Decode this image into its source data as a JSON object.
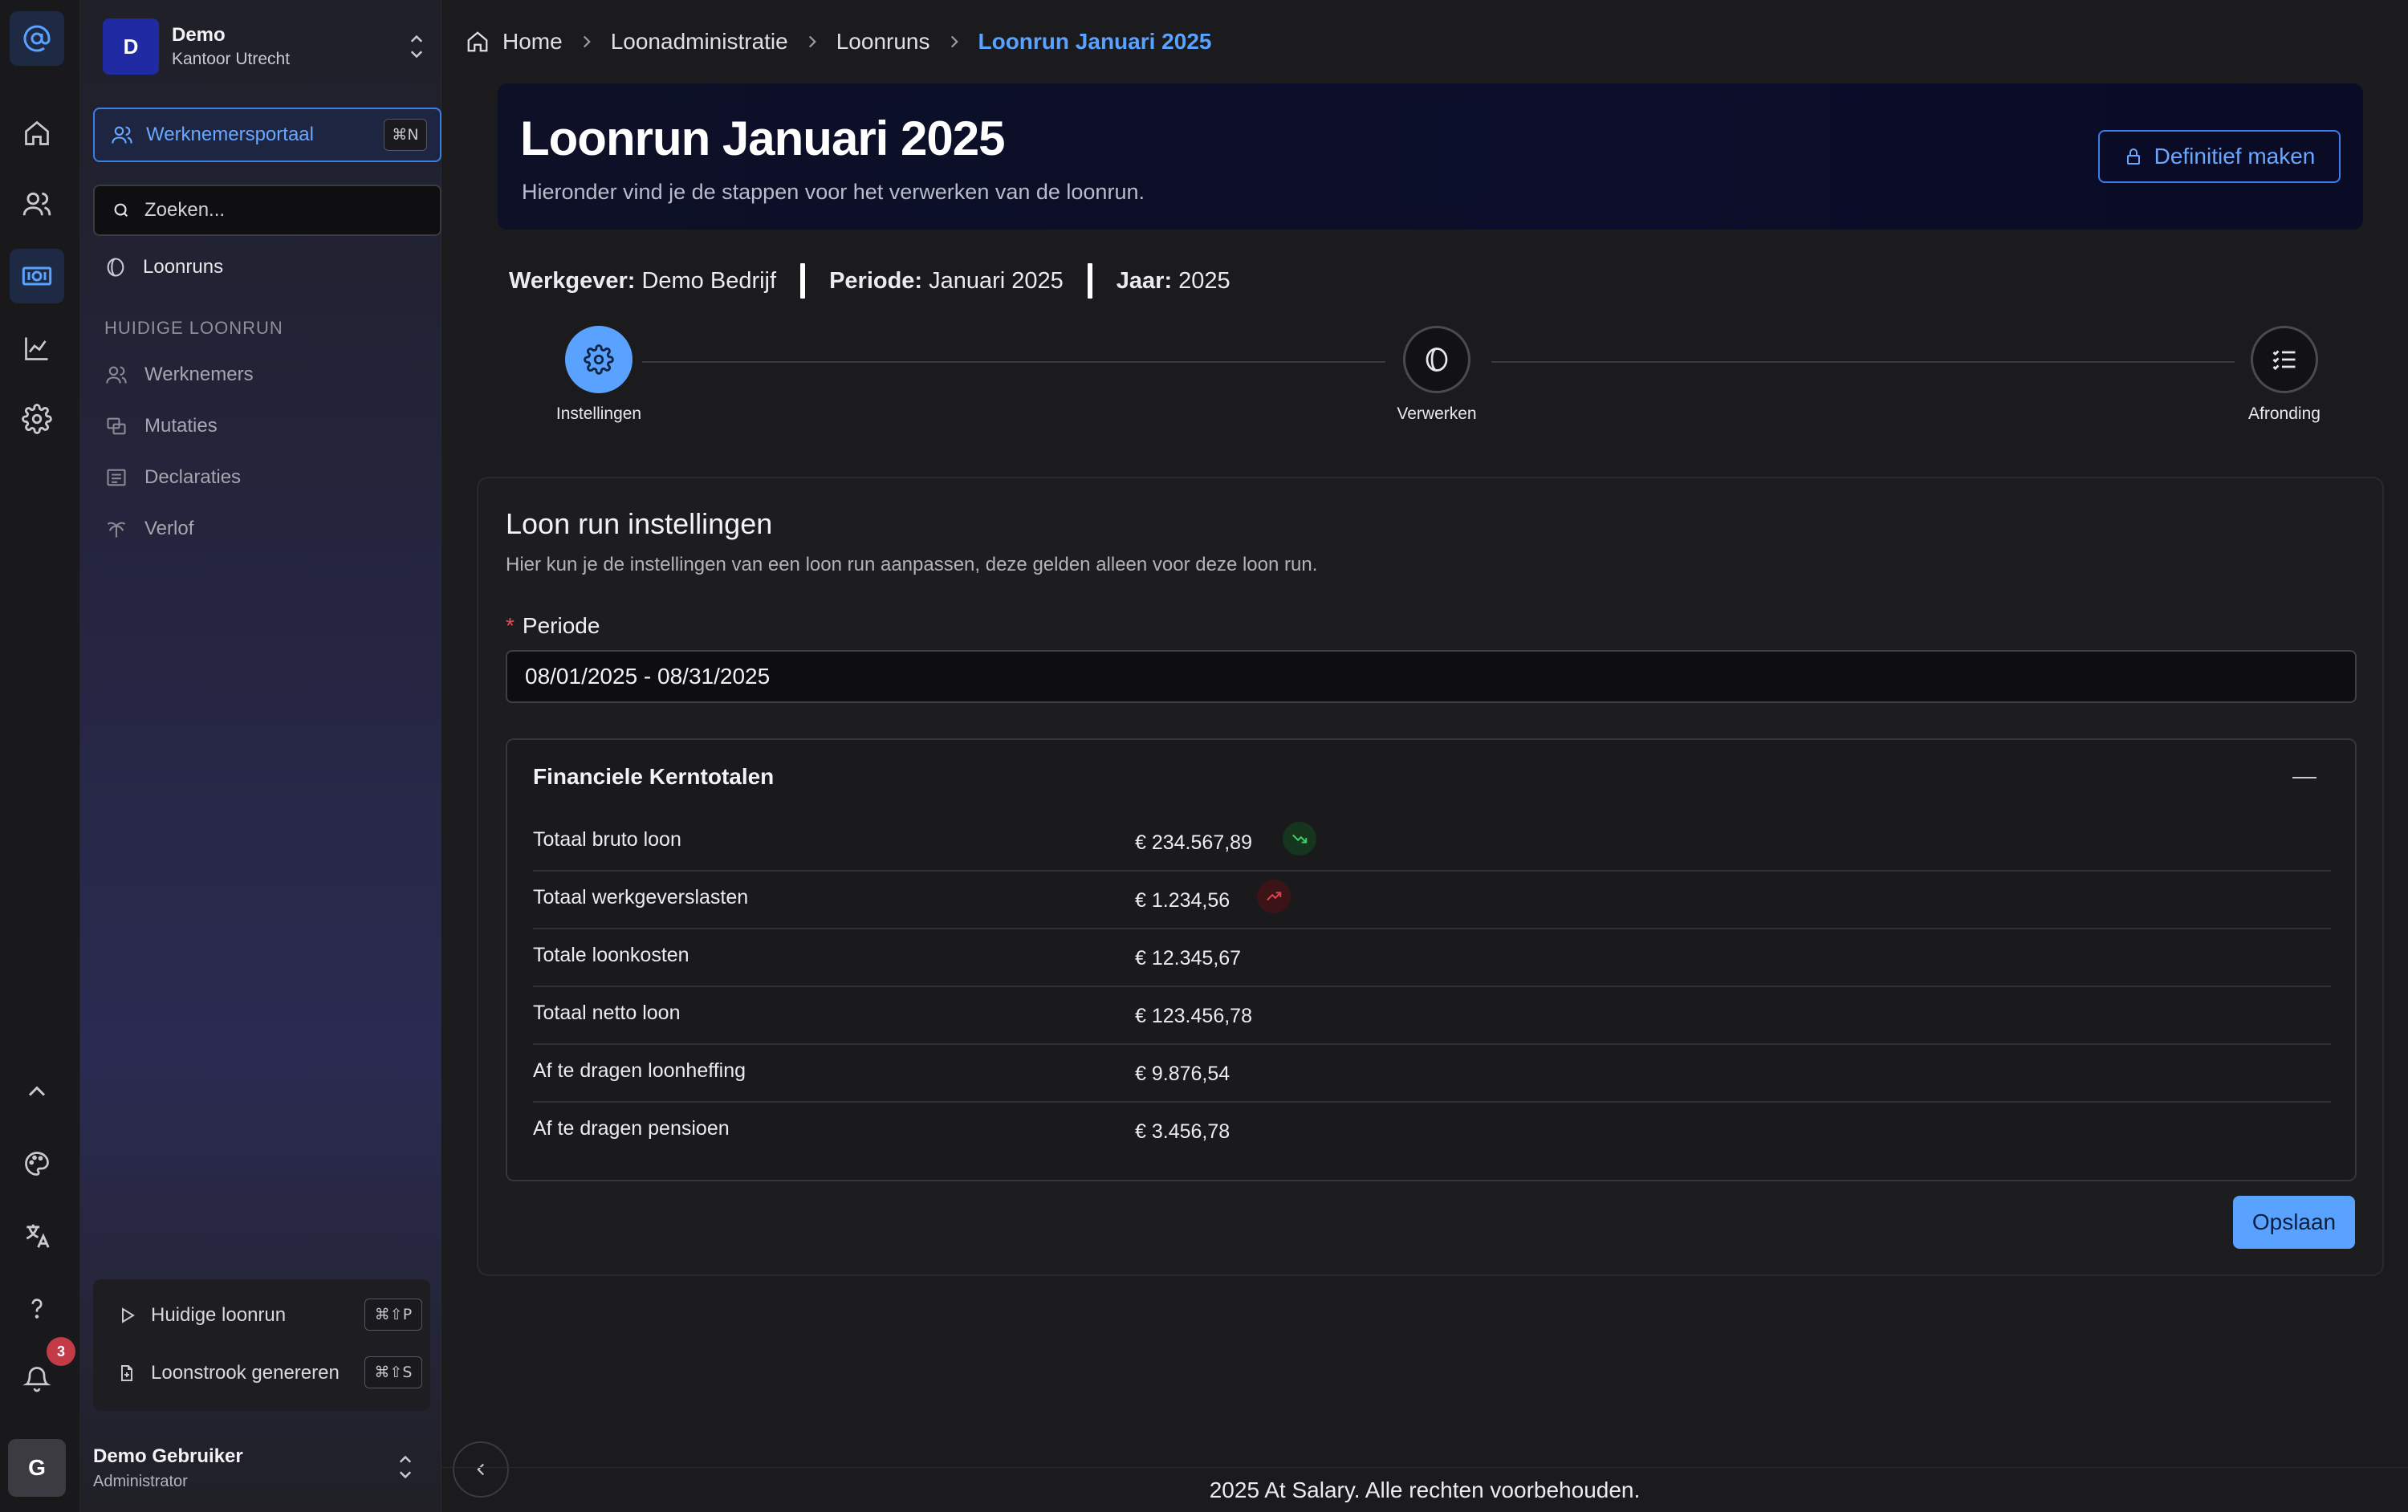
{
  "org": {
    "initial": "D",
    "name": "Demo",
    "office": "Kantoor Utrecht"
  },
  "sidebar": {
    "portal_label": "Werknemersportaal",
    "portal_shortcut": "⌘N",
    "search_placeholder": "Zoeken...",
    "top_items": [
      {
        "label": "Loonruns",
        "icon": "coin-icon"
      }
    ],
    "section_label": "HUIDIGE LOONRUN",
    "section_items": [
      {
        "label": "Werknemers",
        "icon": "users-icon"
      },
      {
        "label": "Mutaties",
        "icon": "swap-icon"
      },
      {
        "label": "Declaraties",
        "icon": "receipt-icon"
      },
      {
        "label": "Verlof",
        "icon": "palm-tree-icon"
      }
    ],
    "quick_actions": [
      {
        "label": "Huidige loonrun",
        "shortcut": "⌘⇧P",
        "icon": "play-icon"
      },
      {
        "label": "Loonstrook genereren",
        "shortcut": "⌘⇧S",
        "icon": "file-plus-icon"
      }
    ]
  },
  "rail": {
    "notification_count": "3"
  },
  "user": {
    "initial": "G",
    "name": "Demo Gebruiker",
    "role": "Administrator"
  },
  "breadcrumb": [
    "Home",
    "Loonadministratie",
    "Loonruns",
    "Loonrun Januari 2025"
  ],
  "hero": {
    "title": "Loonrun Januari 2025",
    "subtitle": "Hieronder vind je de stappen voor het verwerken van de loonrun.",
    "finalize_label": "Definitief maken"
  },
  "meta": [
    {
      "label": "Werkgever:",
      "value": "Demo Bedrijf"
    },
    {
      "label": "Periode:",
      "value": "Januari 2025"
    },
    {
      "label": "Jaar:",
      "value": "2025"
    }
  ],
  "steps": [
    {
      "label": "Instellingen",
      "icon": "gear-icon",
      "active": true
    },
    {
      "label": "Verwerken",
      "icon": "coin-icon",
      "active": false
    },
    {
      "label": "Afronding",
      "icon": "checklist-icon",
      "active": false
    }
  ],
  "settings": {
    "title": "Loon run instellingen",
    "description": "Hier kun je de instellingen van een loon run aanpassen, deze gelden alleen voor deze loon run.",
    "period_label": "Periode",
    "period_value": "08/01/2025 - 08/31/2025",
    "save_label": "Opslaan"
  },
  "totals": {
    "title": "Financiele Kerntotalen",
    "rows": [
      {
        "label": "Totaal bruto loon",
        "value": "€ 234.567,89",
        "trend": "down"
      },
      {
        "label": "Totaal werkgeverslasten",
        "value": "€ 1.234,56",
        "trend": "up"
      },
      {
        "label": "Totale loonkosten",
        "value": "€ 12.345,67"
      },
      {
        "label": "Totaal netto loon",
        "value": "€ 123.456,78"
      },
      {
        "label": "Af te dragen loonheffing",
        "value": "€ 9.876,54"
      },
      {
        "label": "Af te dragen pensioen",
        "value": "€ 3.456,78"
      }
    ]
  },
  "footer": "2025 At Salary. Alle rechten voorbehouden.",
  "colors": {
    "accent": "#5aa2ff",
    "trend_down": "#3fcf6a",
    "trend_up": "#e0434f",
    "badge": "#c23b46"
  }
}
